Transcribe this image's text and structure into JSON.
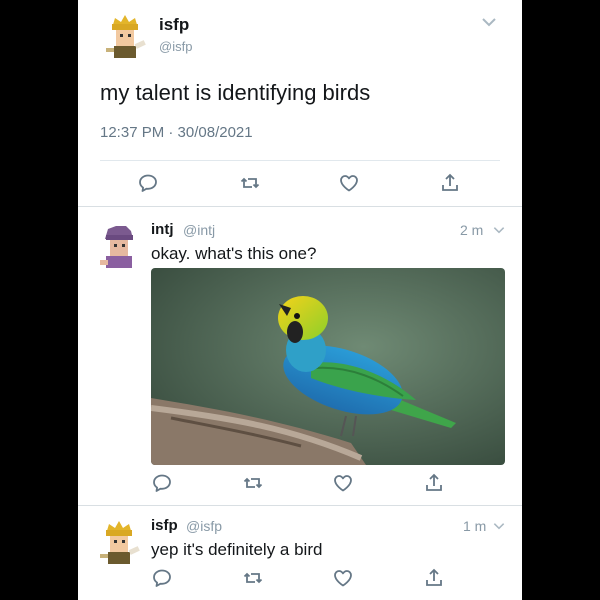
{
  "main_tweet": {
    "display_name": "isfp",
    "handle": "@isfp",
    "text": "my talent is identifying birds",
    "timestamp": "12:37 PM · 30/08/2021",
    "avatar_icon": "cartoon-avatar-yellow-hair",
    "actions": [
      "reply-icon",
      "retweet-icon",
      "like-icon",
      "share-icon"
    ]
  },
  "reply_1": {
    "display_name": "intj",
    "handle": "@intj",
    "age": "2 m",
    "text": "okay. what's this one?",
    "avatar_icon": "cartoon-avatar-purple-hair",
    "image_subject": "colorful-bird-on-branch"
  },
  "reply_2": {
    "display_name": "isfp",
    "handle": "@isfp",
    "age": "1 m",
    "text": "yep it's definitely a bird",
    "avatar_icon": "cartoon-avatar-yellow-hair"
  },
  "colors": {
    "icon_gray": "#657786",
    "text": "#14171a",
    "muted": "#8899a6",
    "background": "#ffffff",
    "frame": "#000000"
  }
}
